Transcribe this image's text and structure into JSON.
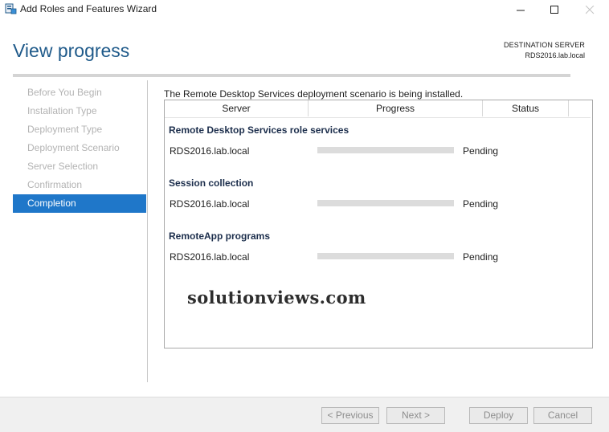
{
  "window": {
    "title": "Add Roles and Features Wizard",
    "icon": "server-manager-icon",
    "minimize_icon": "minimize-icon",
    "maximize_icon": "maximize-icon",
    "close_icon": "close-icon"
  },
  "header": {
    "title": "View progress",
    "destination_label": "DESTINATION SERVER",
    "destination_server": "RDS2016.lab.local"
  },
  "nav": {
    "items": [
      {
        "label": "Before You Begin",
        "state": "disabled"
      },
      {
        "label": "Installation Type",
        "state": "disabled"
      },
      {
        "label": "Deployment Type",
        "state": "disabled"
      },
      {
        "label": "Deployment Scenario",
        "state": "disabled"
      },
      {
        "label": "Server Selection",
        "state": "disabled"
      },
      {
        "label": "Confirmation",
        "state": "disabled"
      },
      {
        "label": "Completion",
        "state": "active"
      }
    ],
    "active_color": "#1f77c9"
  },
  "main": {
    "intro": "The Remote Desktop Services deployment scenario is being installed.",
    "columns": [
      "Server",
      "Progress",
      "Status"
    ],
    "groups": [
      {
        "title": "Remote Desktop Services role services",
        "server": "RDS2016.lab.local",
        "progress": 0,
        "status": "Pending"
      },
      {
        "title": "Session collection",
        "server": "RDS2016.lab.local",
        "progress": 0,
        "status": "Pending"
      },
      {
        "title": "RemoteApp programs",
        "server": "RDS2016.lab.local",
        "progress": 0,
        "status": "Pending"
      }
    ]
  },
  "watermark": "solutionviews.com",
  "footer": {
    "previous": "< Previous",
    "next": "Next >",
    "deploy": "Deploy",
    "cancel": "Cancel"
  }
}
